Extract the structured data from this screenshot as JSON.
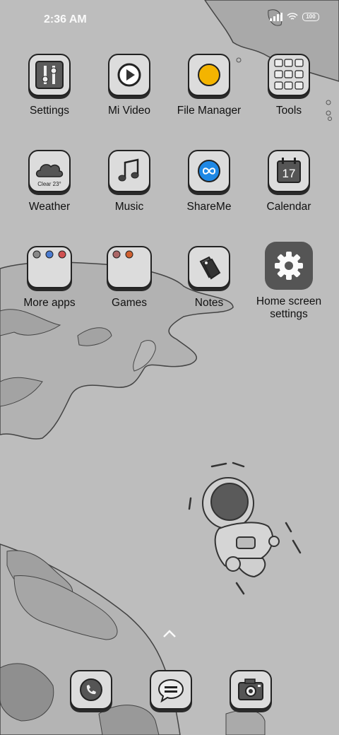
{
  "status_bar": {
    "time": "2:36 AM",
    "battery": "100",
    "icons": [
      "signal-icon",
      "wifi-icon",
      "battery-icon"
    ]
  },
  "apps": [
    {
      "name": "settings",
      "label": "Settings",
      "icon": "settings-sliders-icon"
    },
    {
      "name": "mi-video",
      "label": "Mi Video",
      "icon": "play-icon"
    },
    {
      "name": "file-manager",
      "label": "File Manager",
      "icon": "folder-circle-icon"
    },
    {
      "name": "tools",
      "label": "Tools",
      "icon": "folder-grid-icon"
    },
    {
      "name": "weather",
      "label": "Weather",
      "icon": "cloud-icon",
      "sub": "Clear 23°"
    },
    {
      "name": "music",
      "label": "Music",
      "icon": "music-note-icon"
    },
    {
      "name": "shareme",
      "label": "ShareMe",
      "icon": "infinity-icon"
    },
    {
      "name": "calendar",
      "label": "Calendar",
      "icon": "calendar-icon",
      "sub": "17"
    },
    {
      "name": "more-apps",
      "label": "More apps",
      "icon": "folder-icon"
    },
    {
      "name": "games",
      "label": "Games",
      "icon": "folder-icon"
    },
    {
      "name": "notes",
      "label": "Notes",
      "icon": "notes-icon"
    },
    {
      "name": "home-screen-settings",
      "label": "Home screen settings",
      "icon": "gear-icon"
    }
  ],
  "dock": [
    {
      "name": "phone",
      "icon": "phone-icon"
    },
    {
      "name": "messaging",
      "icon": "message-icon"
    },
    {
      "name": "camera",
      "icon": "camera-icon"
    }
  ],
  "colors": {
    "background": "#bdbdbd",
    "icon_bg": "#dcdcdc",
    "outline": "#222222",
    "file_manager_yellow": "#f4b400",
    "shareme_blue": "#1e88e5"
  }
}
